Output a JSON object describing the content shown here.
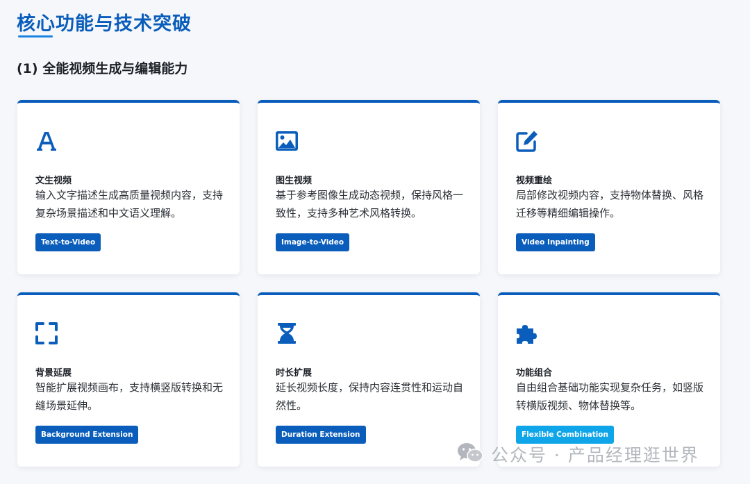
{
  "header": {
    "title": "核心功能与技术突破",
    "subtitle": "(1) 全能视频生成与编辑能力"
  },
  "cards": [
    {
      "title": "文生视频",
      "description": "输入文字描述生成高质量视频内容，支持复杂场景描述和中文语义理解。",
      "tag": "Text-to-Video",
      "icon": "text-font-icon"
    },
    {
      "title": "图生视频",
      "description": "基于参考图像生成动态视频，保持风格一致性，支持多种艺术风格转换。",
      "tag": "Image-to-Video",
      "icon": "image-icon"
    },
    {
      "title": "视频重绘",
      "description": "局部修改视频内容，支持物体替换、风格迁移等精细编辑操作。",
      "tag": "Video Inpainting",
      "icon": "edit-icon"
    },
    {
      "title": "背景延展",
      "description": "智能扩展视频画布，支持横竖版转换和无缝场景延伸。",
      "tag": "Background Extension",
      "icon": "expand-icon"
    },
    {
      "title": "时长扩展",
      "description": "延长视频长度，保持内容连贯性和运动自然性。",
      "tag": "Duration Extension",
      "icon": "hourglass-icon"
    },
    {
      "title": "功能组合",
      "description": "自由组合基础功能实现复杂任务，如竖版转横版视频、物体替换等。",
      "tag": "Flexible Combination",
      "icon": "puzzle-icon"
    }
  ],
  "watermark": {
    "text": "公众号 · 产品经理逛世界",
    "icon": "wechat-icon"
  },
  "colors": {
    "accent": "#0a5dbb",
    "title": "#0a5dbb",
    "tag_default": "#0a5dbb",
    "tag_highlight": "#0ea5e9",
    "background": "#f5f7fa"
  }
}
